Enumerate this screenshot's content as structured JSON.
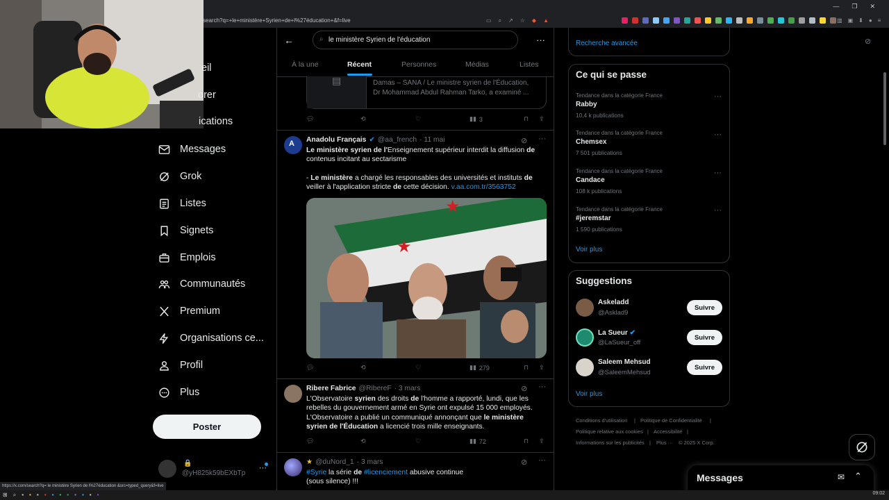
{
  "browser": {
    "url": "search?q=+le+ministère+Syrien+de+l%27éducation+&f=live",
    "status_url": "https://x.com/search?q= le ministère Syrien de l%27éducation &src=typed_query&f=live",
    "clock": "09:02"
  },
  "nav": {
    "partial_items": [
      "eil",
      "orer",
      "ications"
    ],
    "items": [
      {
        "label": "Messages",
        "icon": "envelope-icon"
      },
      {
        "label": "Grok",
        "icon": "grok-icon"
      },
      {
        "label": "Listes",
        "icon": "list-icon"
      },
      {
        "label": "Signets",
        "icon": "bookmark-icon"
      },
      {
        "label": "Emplois",
        "icon": "briefcase-icon"
      },
      {
        "label": "Communautés",
        "icon": "people-icon"
      },
      {
        "label": "Premium",
        "icon": "x-logo-icon"
      },
      {
        "label": "Organisations ce...",
        "icon": "lightning-icon"
      },
      {
        "label": "Profil",
        "icon": "person-icon"
      },
      {
        "label": "Plus",
        "icon": "more-circle-icon"
      }
    ],
    "post_label": "Poster",
    "account_handle": "@yH825k59bEXbTp"
  },
  "search": {
    "query": "le ministère Syrien de l'éducation",
    "tabs": [
      "À la une",
      "Récent",
      "Personnes",
      "Médias",
      "Listes"
    ],
    "active_tab": "Récent"
  },
  "tweets": [
    {
      "card_text_1": "Damas – SANA / Le ministre syrien de l'Éducation,",
      "card_text_2": "Dr Mohammad Abdul Rahman Tarko, a examiné ...",
      "views": "3"
    },
    {
      "name": "Anadolu Français",
      "handle": "@aa_french",
      "date": "· 11 mai",
      "line1_bold": "Le ministère syrien de l'",
      "line1_rest": "Enseignement supérieur interdit la diffusion ",
      "line1_bold2": "de",
      "line2": "contenus incitant au sectarisme",
      "line3_pre": "- ",
      "line3_bold": "Le ministère",
      "line3_rest": " a chargé les responsables des universités et instituts ",
      "line3_bold2": "de",
      "line4_pre": "veiller à l'application stricte ",
      "line4_bold": "de",
      "line4_rest": " cette décision. ",
      "link": "v.aa.com.tr/3563752",
      "views": "279"
    },
    {
      "name": "Ribere Fabrice",
      "handle": "@RibereF",
      "date": "· 3 mars",
      "l1a": "L'Observatoire ",
      "l1b": "syrien",
      "l1c": " des droits ",
      "l1d": "de",
      "l1e": " l'homme a rapporté, lundi, que les",
      "l2": "rebelles du gouvernement armé en Syrie ont expulsé 15 000 employés.",
      "l3a": " L'Observatoire a publié un communiqué annonçant que ",
      "l3b": "le ministère",
      "l4a": "syrien de l'Éducation",
      "l4b": " a licencié trois mille enseignants.",
      "views": "72"
    },
    {
      "handle": "@duNord_1",
      "date": "· 3 mars",
      "hash1": "#Syrie",
      "mid1": " la série ",
      "mid_bold": "de",
      "hash2": "#licenciement",
      "tail": " abusive continue",
      "l2": "(sous silence) !!!"
    }
  ],
  "right": {
    "advanced_search": "Recherche avancée",
    "trends_title": "Ce qui se passe",
    "trends": [
      {
        "category": "Tendance dans la catégorie France",
        "name": "Rabby",
        "count": "10,4 k publications"
      },
      {
        "category": "Tendance dans la catégorie France",
        "name": "Chemsex",
        "count": "7 501 publications"
      },
      {
        "category": "Tendance dans la catégorie France",
        "name": "Candace",
        "count": "108 k publications"
      },
      {
        "category": "Tendance dans la catégorie France",
        "name": "#jeremstar",
        "count": "1 590 publications"
      }
    ],
    "show_more": "Voir plus",
    "suggestions_title": "Suggestions",
    "suggestions": [
      {
        "name": "Askeladd",
        "handle": "@Asklad9",
        "button": "Suivre"
      },
      {
        "name": "La Sueur",
        "handle": "@LaSueur_off",
        "button": "Suivre"
      },
      {
        "name": "Saleem Mehsud",
        "handle": "@SaleemMehsud",
        "button": "Suivre"
      }
    ],
    "footer": [
      "Conditions d'utilisation",
      "|",
      "Politique de Confidentialité",
      "|",
      "Politique relative aux cookies",
      "|",
      "Accessibilité",
      "|",
      "Informations sur les publicités",
      "|",
      "Plus ···",
      "© 2025 X Corp."
    ],
    "messages_drawer": "Messages"
  },
  "colors": {
    "accent": "#1d9bf0",
    "background": "#000000",
    "border": "#2f3336"
  }
}
